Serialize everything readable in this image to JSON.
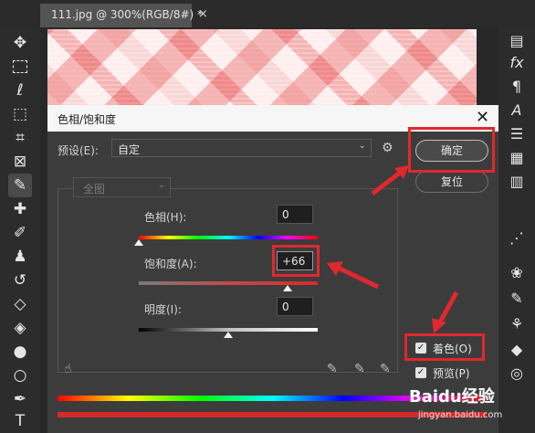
{
  "document": {
    "tab_label": "111.jpg @ 300%(RGB/8#) *",
    "close_label": "×"
  },
  "dialog": {
    "title": "色相/饱和度",
    "close_label": "✕",
    "preset_label": "预设(E):",
    "preset_value": "自定",
    "channel_value": "全图",
    "ok_label": "确定",
    "reset_label": "复位",
    "hue": {
      "label": "色相(H):",
      "value": "0",
      "level": 0.0
    },
    "saturation": {
      "label": "饱和度(A):",
      "value": "+66",
      "level": 0.83
    },
    "lightness": {
      "label": "明度(I):",
      "value": "0",
      "level": 0.5
    },
    "colorize": {
      "label": "着色(O)",
      "checked": true
    },
    "preview": {
      "label": "预览(P)",
      "checked": true
    }
  },
  "watermark": {
    "brand": "Baidu经验",
    "url": "jingyan.baidu.com"
  },
  "colors": {
    "highlight": "#e0282e",
    "saturation_bar": "#d62a2a"
  }
}
